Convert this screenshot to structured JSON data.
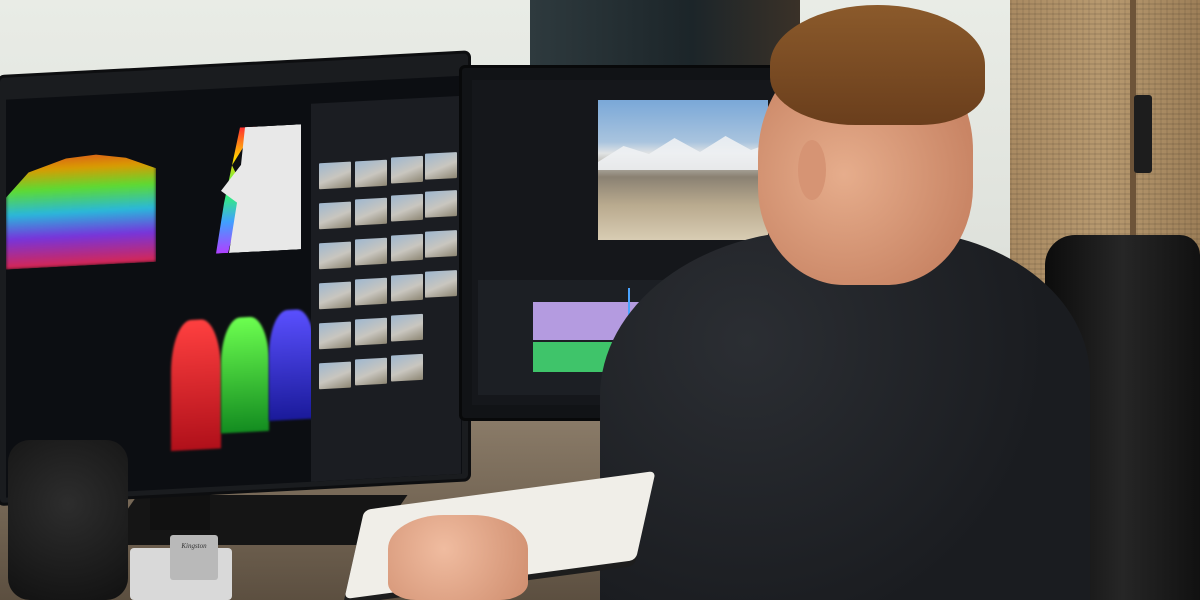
{
  "scene": {
    "brand_text": "Kingston"
  },
  "colors": {
    "wall": "#e9ece6",
    "desk": "#8a7b68",
    "shirt": "#1f2125",
    "hair": "#7a4a24",
    "timeline_purple": "#b49be0",
    "timeline_green": "#3fc46a"
  }
}
